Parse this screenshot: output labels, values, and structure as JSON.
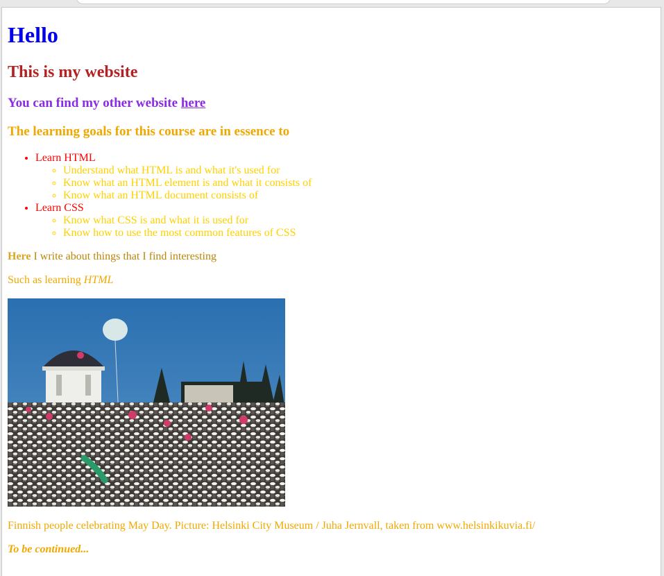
{
  "page": {
    "title": "Hello",
    "subtitle": "This is my website",
    "other_site": {
      "text": "You can find my other website",
      "link_text": "here"
    },
    "goals_heading": "The learning goals for this course are in essence to",
    "goals": [
      {
        "label": "Learn HTML",
        "items": [
          "Understand what HTML is and what it's used for",
          "Know what an HTML element is and what it consists of",
          "Know what an HTML document consists of"
        ]
      },
      {
        "label": "Learn CSS",
        "items": [
          "Know what CSS is and what it is used for",
          "Know how to use the most common features of CSS"
        ]
      }
    ],
    "about": {
      "bold": "Here",
      "rest": " I write about things that I find interesting"
    },
    "learning": {
      "text": "Such as learning ",
      "em": "HTML"
    },
    "caption": "Finnish people celebrating May Day. Picture: Helsinki City Museum / Juha Jernvall, taken from www.helsinkikuvia.fi/",
    "continued": "To be continued..."
  },
  "colors": {
    "heading1": "#0000ee",
    "heading2": "#b22222",
    "other_site": "#8a2be2",
    "goals": "#f0a800",
    "list_top": "#ff0000",
    "list_sub": "#ffd000"
  }
}
